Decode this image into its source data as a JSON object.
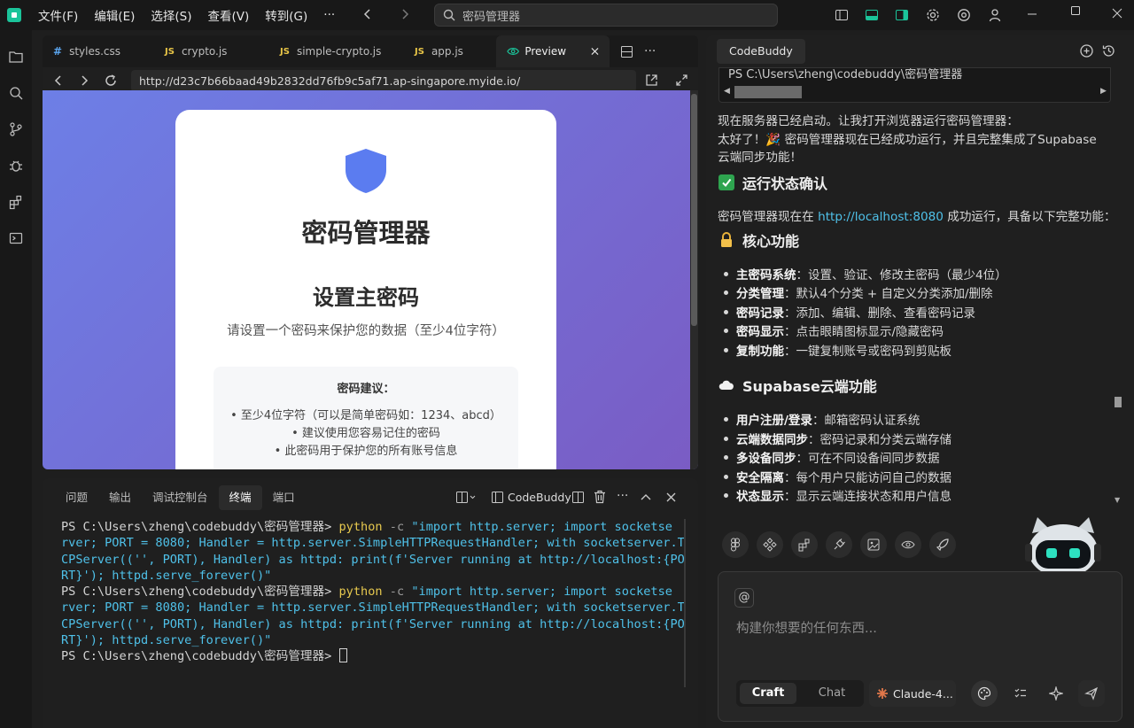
{
  "menu": [
    "文件(F)",
    "编辑(E)",
    "选择(S)",
    "查看(V)",
    "转到(G)",
    "···"
  ],
  "search": {
    "text": "密码管理器"
  },
  "editor_tabs": [
    {
      "icon": "#",
      "label": "styles.css"
    },
    {
      "icon": "JS",
      "label": "crypto.js"
    },
    {
      "icon": "JS",
      "label": "simple-crypto.js"
    },
    {
      "icon": "JS",
      "label": "app.js"
    }
  ],
  "preview_tab": {
    "label": "Preview"
  },
  "url": "http://d23c7b66baad49b2832dd76fb9c5af71.ap-singapore.myide.io/",
  "app": {
    "title": "密码管理器",
    "heading": "设置主密码",
    "subtitle": "请设置一个密码来保护您的数据（至少4位字符）",
    "tips_title": "密码建议：",
    "tips": [
      "• 至少4位字符（可以是简单密码如：1234、abcd）",
      "• 建议使用您容易记住的密码",
      "• 此密码用于保护您的所有账号信息"
    ]
  },
  "panel": {
    "tabs": [
      "问题",
      "输出",
      "调试控制台",
      "终端",
      "端口"
    ],
    "codebuddy": "CodeBuddy"
  },
  "terminal": {
    "prompt": "PS C:\\Users\\zheng\\codebuddy\\密码管理器> ",
    "cmd": "python",
    "flag": " -c ",
    "l1": "\"import http.server; import socketse",
    "l2": "rver; PORT = 8080; Handler = http.server.SimpleHTTPRequestHandler; with socketserver.T",
    "l3": "CPServer(('', PORT), Handler) as httpd: print(f'Server running at http://localhost:{PO",
    "l4": "RT}'); httpd.serve_forever()\""
  },
  "right": {
    "tab": "CodeBuddy",
    "code_line": "PS C:\\Users\\zheng\\codebuddy\\密码管理器",
    "p1": "现在服务器已经启动。让我打开浏览器运行密码管理器：",
    "p2": "太好了！🎉 密码管理器现在已经成功运行，并且完整集成了Supabase",
    "p3": "云端同步功能！",
    "h1": "运行状态确认",
    "p4a": "密码管理器现在在 ",
    "p4link": "http://localhost:8080",
    "p4b": " 成功运行，具备以下完整功能：",
    "h2": "核心功能",
    "core": [
      {
        "k": "主密码系统",
        "v": "：设置、验证、修改主密码（最少4位）"
      },
      {
        "k": "分类管理",
        "v": "：默认4个分类 + 自定义分类添加/删除"
      },
      {
        "k": "密码记录",
        "v": "：添加、编辑、删除、查看密码记录"
      },
      {
        "k": "密码显示",
        "v": "：点击眼睛图标显示/隐藏密码"
      },
      {
        "k": "复制功能",
        "v": "：一键复制账号或密码到剪贴板"
      }
    ],
    "h3": "Supabase云端功能",
    "cloud": [
      {
        "k": "用户注册/登录",
        "v": "：邮箱密码认证系统"
      },
      {
        "k": "云端数据同步",
        "v": "：密码记录和分类云端存储"
      },
      {
        "k": "多设备同步",
        "v": "：可在不同设备间同步数据"
      },
      {
        "k": "安全隔离",
        "v": "：每个用户只能访问自己的数据"
      },
      {
        "k": "状态显示",
        "v": "：显示云端连接状态和用户信息"
      }
    ],
    "at": "@",
    "placeholder": "构建你想要的任何东西...",
    "mode_craft": "Craft",
    "mode_chat": "Chat",
    "model": "Claude-4..."
  },
  "colors": {
    "accent": "#1bc49a",
    "link": "#4fc1e9",
    "gradient_start": "#6d7fe6",
    "gradient_end": "#7a5cc4",
    "shield": "#5b7cf0"
  }
}
